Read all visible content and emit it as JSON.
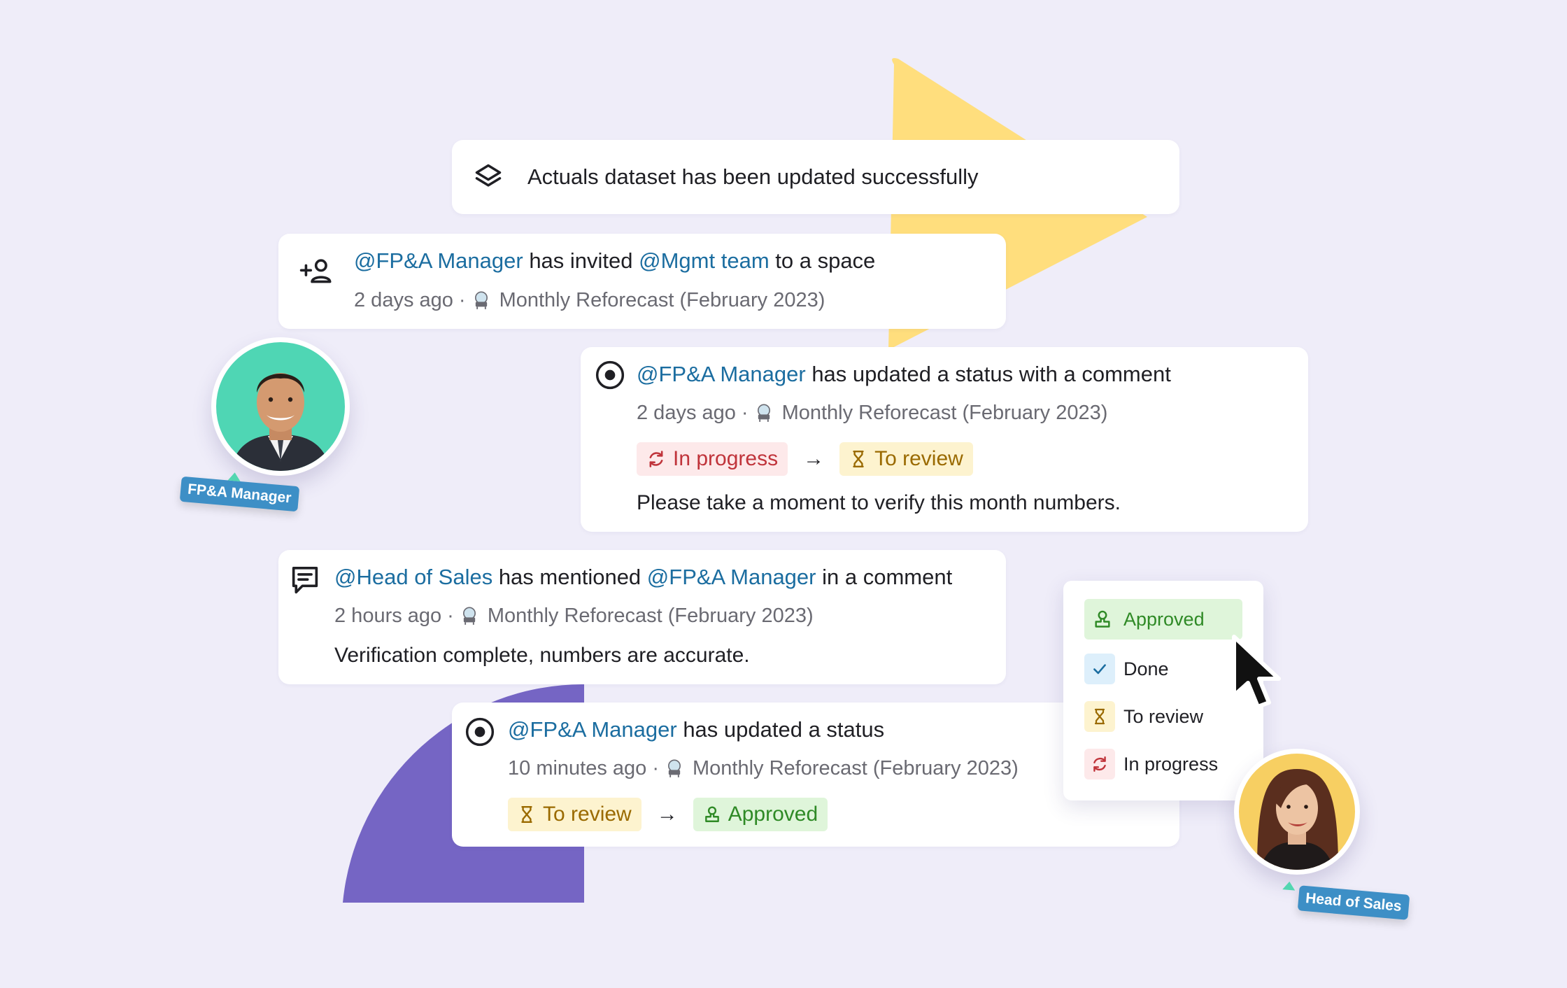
{
  "colors": {
    "background": "#EFEDF9",
    "mention": "#1B6DA0",
    "accent_yellow": "#FFDE7D",
    "accent_purple": "#7565C4",
    "avatar_fpa_bg": "#4FD6B4",
    "avatar_sales_bg": "#F7CF62",
    "tag_bg": "#3D8FC6"
  },
  "notice": {
    "icon": "layers-icon",
    "text": "Actuals dataset has been updated successfully"
  },
  "invite": {
    "icon": "add-user-icon",
    "actor": "@FP&A Manager",
    "verb": " has invited ",
    "target": "@Mgmt team",
    "suffix": " to a space",
    "time": "2 days ago",
    "dot": "·",
    "space": "Monthly Reforecast (February 2023)"
  },
  "status_comment": {
    "icon": "status-icon",
    "actor": "@FP&A Manager",
    "action": " has updated a status with a comment",
    "time": "2 days ago",
    "dot": "·",
    "space": "Monthly Reforecast (February 2023)",
    "from_status": "In progress",
    "arrow": "→",
    "to_status": "To review",
    "comment": "Please take a moment to verify this month numbers."
  },
  "mention": {
    "icon": "comment-icon",
    "actor": "@Head of Sales",
    "verb": " has mentioned ",
    "target": "@FP&A Manager",
    "suffix": " in a comment",
    "time": "2 hours ago",
    "dot": "·",
    "space": "Monthly Reforecast (February 2023)",
    "comment": "Verification complete, numbers are accurate."
  },
  "status_update": {
    "icon": "status-icon",
    "actor": "@FP&A Manager",
    "action": " has updated a status",
    "time": "10 minutes ago",
    "dot": "·",
    "space": "Monthly Reforecast (February 2023)",
    "from_status": "To review",
    "arrow": "→",
    "to_status": "Approved"
  },
  "status_menu": {
    "items": [
      {
        "label": "Approved",
        "icon": "stamp-icon",
        "selected": true
      },
      {
        "label": "Done",
        "icon": "check-icon",
        "selected": false
      },
      {
        "label": "To review",
        "icon": "hourglass-icon",
        "selected": false
      },
      {
        "label": "In progress",
        "icon": "refresh-icon",
        "selected": false
      }
    ]
  },
  "users": {
    "fpa_manager": "FP&A Manager",
    "head_of_sales": "Head of Sales"
  }
}
